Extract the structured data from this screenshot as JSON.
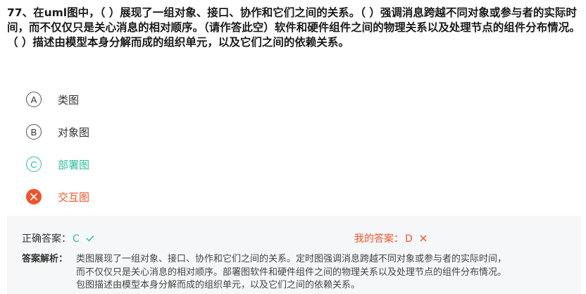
{
  "question": {
    "number": "77",
    "separator": "、",
    "text": "在uml图中，（ ）展现了一组对象、接口、协作和它们之间的关系。（ ）强调消息跨越不同对象或参与者的实际时间，而不仅仅只是关心消息的相对顺序。（请作答此空）软件和硬件组件之间的物理关系以及处理节点的组件分布情况。（ ）描述由模型本身分解而成的组织单元，以及它们之间的依赖关系。"
  },
  "options": [
    {
      "letter": "A",
      "text": "类图",
      "state": "normal"
    },
    {
      "letter": "B",
      "text": "对象图",
      "state": "normal"
    },
    {
      "letter": "C",
      "text": "部署图",
      "state": "correct"
    },
    {
      "letter": "D",
      "text": "交互图",
      "state": "wrong"
    }
  ],
  "answer": {
    "correct_label": "正确答案：",
    "correct_value": "C",
    "my_label": "我的答案：",
    "my_value": "D",
    "explain_label": "答案解析：",
    "explain_lines": [
      "类图展现了一组对象、接口、协作和它们之间的关系。定时图强调消息跨越不同对象或参与者的实际时间，",
      "而不仅仅只是关心消息的相对顺序。部署图软件和硬件组件之间的物理关系以及处理节点的组件分布情况。",
      "包图描述由模型本身分解而成的组织单元，以及它们之间的依赖关系。"
    ]
  },
  "colors": {
    "correct": "#2fbf9a",
    "wrong": "#f0542d",
    "panel_bg": "#f6f7f8"
  },
  "icons": {
    "correct_mark": "check-icon",
    "wrong_mark": "cross-icon"
  }
}
